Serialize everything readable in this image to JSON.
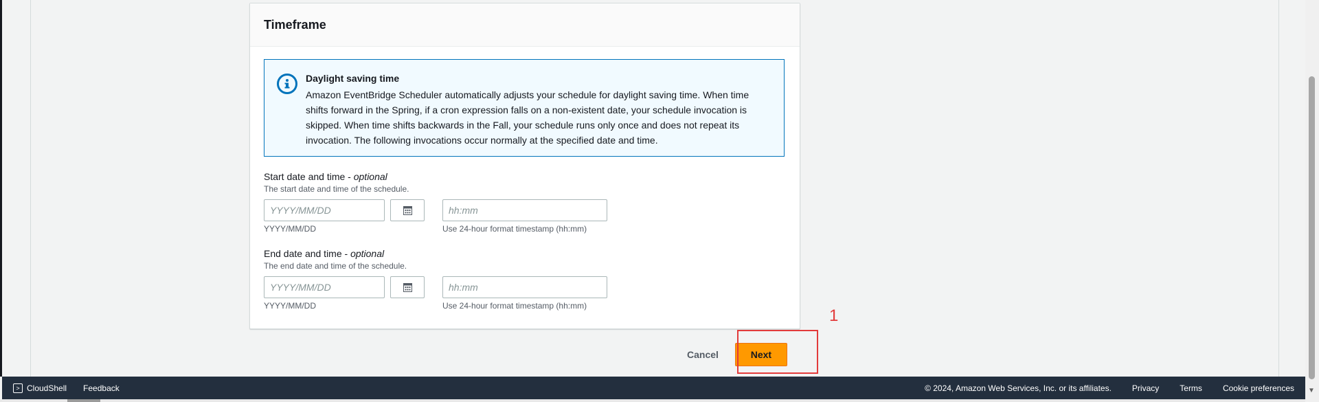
{
  "section": {
    "title": "Timeframe"
  },
  "alert": {
    "icon": "info-icon",
    "title": "Daylight saving time",
    "lines": [
      "Amazon EventBridge Scheduler automatically adjusts your schedule for daylight saving time. When time",
      "shifts forward in the Spring, if a cron expression falls on a non-existent date, your schedule invocation is",
      "skipped. When time shifts backwards in the Fall, your schedule runs only once and does not repeat its",
      "invocation. The following invocations occur normally at the specified date and time."
    ]
  },
  "start": {
    "label": "Start date and time - ",
    "optional": "optional",
    "description": "The start date and time of the schedule.",
    "date_placeholder": "YYYY/MM/DD",
    "time_placeholder": "hh:mm",
    "date_hint": "YYYY/MM/DD",
    "time_hint": "Use 24-hour format timestamp (hh:mm)"
  },
  "end": {
    "label": "End date and time - ",
    "optional": "optional",
    "description": "The end date and time of the schedule.",
    "date_placeholder": "YYYY/MM/DD",
    "time_placeholder": "hh:mm",
    "date_hint": "YYYY/MM/DD",
    "time_hint": "Use 24-hour format timestamp (hh:mm)"
  },
  "actions": {
    "cancel": "Cancel",
    "next": "Next",
    "annotation": "1"
  },
  "footer": {
    "cloudshell": "CloudShell",
    "feedback": "Feedback",
    "copyright": "© 2024, Amazon Web Services, Inc. or its affiliates.",
    "privacy": "Privacy",
    "terms": "Terms",
    "cookie": "Cookie preferences"
  },
  "colors": {
    "primary_button": "#ff9900",
    "info_border": "#0073bb",
    "footer_bg": "#232f3e",
    "annotation": "#e23a3a"
  }
}
